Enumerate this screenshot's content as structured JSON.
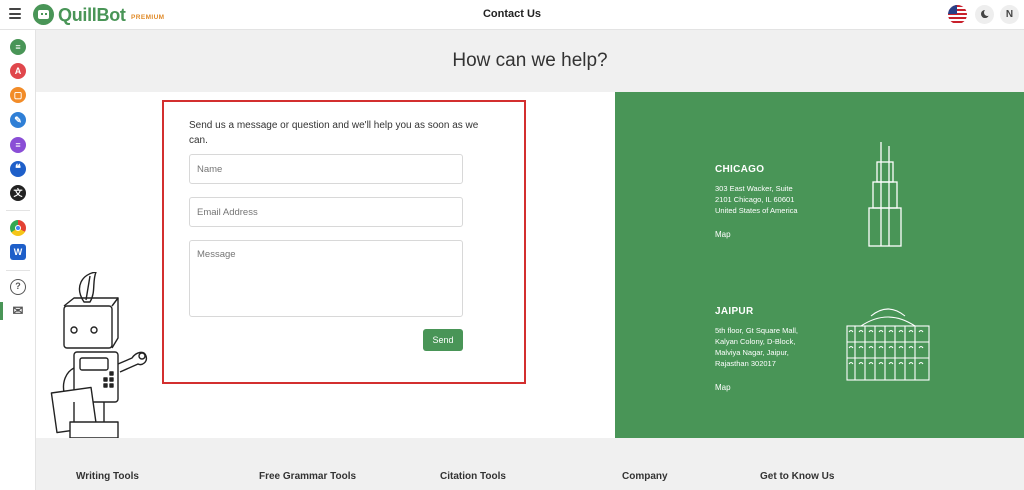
{
  "header": {
    "logo_text": "QuillBot",
    "logo_badge": "PREMIUM",
    "title": "Contact Us",
    "avatar_initial": "N"
  },
  "sidebar": {
    "items": [
      {
        "name": "paraphraser-icon",
        "color": "#499557",
        "glyph": "≡"
      },
      {
        "name": "grammar-checker-icon",
        "color": "#e0474c",
        "glyph": "A"
      },
      {
        "name": "plagiarism-checker-icon",
        "color": "#f28c28",
        "glyph": "⊡"
      },
      {
        "name": "co-writer-icon",
        "color": "#2f7fd6",
        "glyph": "✎"
      },
      {
        "name": "summarizer-icon",
        "color": "#8a4ed6",
        "glyph": "≡"
      },
      {
        "name": "citation-generator-icon",
        "color": "#1e5fc9",
        "glyph": "❝"
      },
      {
        "name": "translator-icon",
        "color": "#222222",
        "glyph": "文"
      },
      {
        "name": "chrome-extension-icon",
        "color": "#e34133",
        "glyph": "◉"
      },
      {
        "name": "word-addin-icon",
        "color": "#1e5fc9",
        "glyph": "W"
      },
      {
        "name": "help-icon",
        "color": "#ffffff",
        "glyph": "?"
      },
      {
        "name": "contact-mail-icon",
        "color": "#ffffff",
        "glyph": "✉"
      }
    ]
  },
  "hero": {
    "title": "How can we help?"
  },
  "form": {
    "intro": "Send us a message or question and we'll help you as soon as we can.",
    "name_placeholder": "Name",
    "email_placeholder": "Email Address",
    "message_placeholder": "Message",
    "send_label": "Send"
  },
  "offices": [
    {
      "city": "CHICAGO",
      "address_lines": [
        "303 East Wacker, Suite",
        "2101 Chicago, IL 60601",
        "United States of America"
      ],
      "map_label": "Map"
    },
    {
      "city": "JAIPUR",
      "address_lines": [
        "5th floor, Gt Square Mall,",
        "Kalyan Colony, D-Block,",
        "Malviya Nagar, Jaipur,",
        "Rajasthan 302017"
      ],
      "map_label": "Map"
    }
  ],
  "footer": {
    "columns": [
      "Writing Tools",
      "Free Grammar Tools",
      "Citation Tools",
      "Company",
      "Get to Know Us"
    ]
  },
  "colors": {
    "brand": "#499557",
    "highlight": "#d32f2f",
    "premium": "#e08b2a"
  }
}
